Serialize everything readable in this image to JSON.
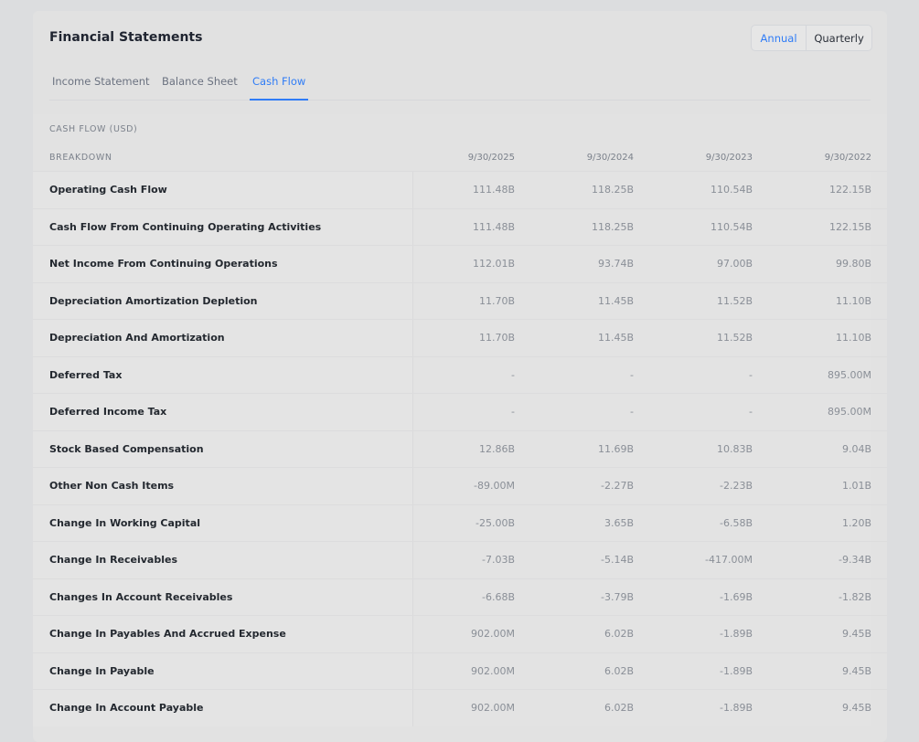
{
  "header": {
    "title": "Financial Statements",
    "period_toggle": {
      "annual": "Annual",
      "quarterly": "Quarterly",
      "selected": "Annual"
    }
  },
  "tabs": [
    {
      "label": "Income Statement",
      "active": false
    },
    {
      "label": "Balance Sheet",
      "active": false
    },
    {
      "label": "Cash Flow",
      "active": true
    }
  ],
  "table": {
    "section_label": "CASH FLOW (USD)",
    "breakdown_label": "BREAKDOWN",
    "columns": [
      "9/30/2025",
      "9/30/2024",
      "9/30/2023",
      "9/30/2022"
    ],
    "rows": [
      {
        "label": "Operating Cash Flow",
        "values": [
          "111.48B",
          "118.25B",
          "110.54B",
          "122.15B"
        ]
      },
      {
        "label": "Cash Flow From Continuing Operating Activities",
        "values": [
          "111.48B",
          "118.25B",
          "110.54B",
          "122.15B"
        ]
      },
      {
        "label": "Net Income From Continuing Operations",
        "values": [
          "112.01B",
          "93.74B",
          "97.00B",
          "99.80B"
        ]
      },
      {
        "label": "Depreciation Amortization Depletion",
        "values": [
          "11.70B",
          "11.45B",
          "11.52B",
          "11.10B"
        ]
      },
      {
        "label": "Depreciation And Amortization",
        "values": [
          "11.70B",
          "11.45B",
          "11.52B",
          "11.10B"
        ]
      },
      {
        "label": "Deferred Tax",
        "values": [
          "-",
          "-",
          "-",
          "895.00M"
        ]
      },
      {
        "label": "Deferred Income Tax",
        "values": [
          "-",
          "-",
          "-",
          "895.00M"
        ]
      },
      {
        "label": "Stock Based Compensation",
        "values": [
          "12.86B",
          "11.69B",
          "10.83B",
          "9.04B"
        ]
      },
      {
        "label": "Other Non Cash Items",
        "values": [
          "-89.00M",
          "-2.27B",
          "-2.23B",
          "1.01B"
        ]
      },
      {
        "label": "Change In Working Capital",
        "values": [
          "-25.00B",
          "3.65B",
          "-6.58B",
          "1.20B"
        ]
      },
      {
        "label": "Change In Receivables",
        "values": [
          "-7.03B",
          "-5.14B",
          "-417.00M",
          "-9.34B"
        ]
      },
      {
        "label": "Changes In Account Receivables",
        "values": [
          "-6.68B",
          "-3.79B",
          "-1.69B",
          "-1.82B"
        ]
      },
      {
        "label": "Change In Payables And Accrued Expense",
        "values": [
          "902.00M",
          "6.02B",
          "-1.89B",
          "9.45B"
        ]
      },
      {
        "label": "Change In Payable",
        "values": [
          "902.00M",
          "6.02B",
          "-1.89B",
          "9.45B"
        ]
      },
      {
        "label": "Change In Account Payable",
        "values": [
          "902.00M",
          "6.02B",
          "-1.89B",
          "9.45B"
        ]
      }
    ]
  },
  "colors": {
    "accent": "#2f7cf6",
    "page_bg": "#dcdddf",
    "card_bg": "#e2e2e2"
  }
}
